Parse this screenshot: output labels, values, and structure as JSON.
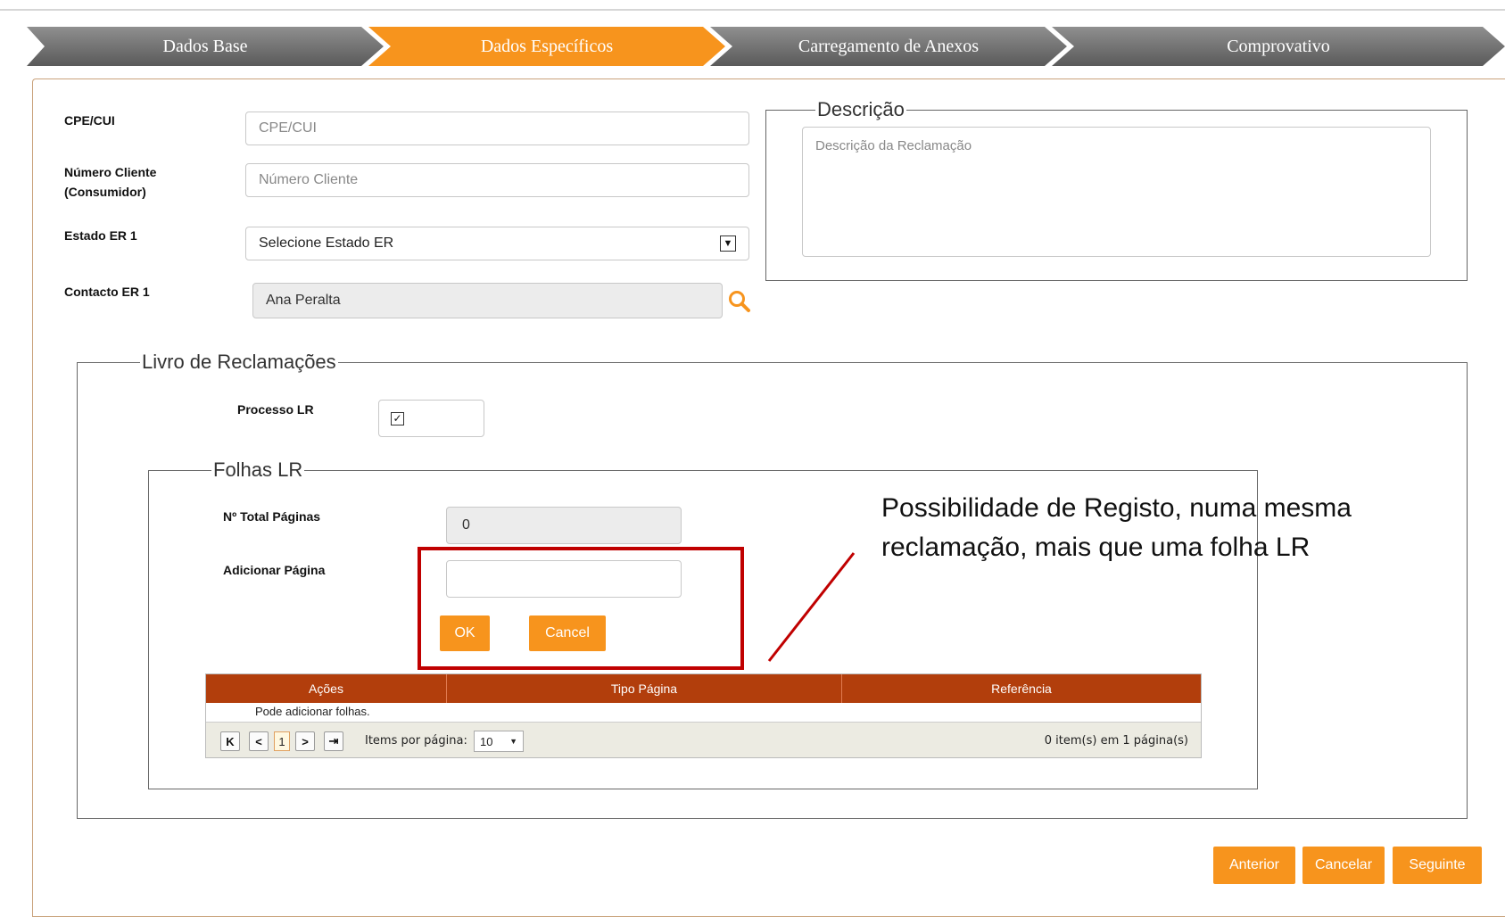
{
  "steps": [
    "Dados Base",
    "Dados Específicos",
    "Carregamento de Anexos",
    "Comprovativo"
  ],
  "form": {
    "cpe_label": "CPE/CUI",
    "cpe_placeholder": "CPE/CUI",
    "numero_label": "Número Cliente (Consumidor)",
    "numero_placeholder": "Número Cliente",
    "estado_label": "Estado ER 1",
    "estado_value": "Selecione Estado ER",
    "contacto_label": "Contacto ER 1",
    "contacto_value": "Ana Peralta"
  },
  "descricao": {
    "legend": "Descrição",
    "placeholder": "Descrição da Reclamação"
  },
  "livro": {
    "legend": "Livro de Reclamações",
    "processo_label": "Processo LR",
    "processo_checked": true
  },
  "folhas": {
    "legend": "Folhas LR",
    "total_label": "Nº Total Páginas",
    "total_value": "0",
    "adicionar_label": "Adicionar Página",
    "adicionar_value": "",
    "ok_label": "OK",
    "cancel_label": "Cancel"
  },
  "grid": {
    "columns": [
      "Ações",
      "Tipo Página",
      "Referência"
    ],
    "empty_message": "Pode adicionar folhas.",
    "current_page": "1",
    "items_per_page_label": "Items por página:",
    "items_per_page_value": "10",
    "summary": "0 item(s) em 1 página(s)"
  },
  "annotation": "Possibilidade de Registo, numa mesma reclamação, mais que uma folha LR",
  "footer": {
    "anterior": "Anterior",
    "cancelar": "Cancelar",
    "seguinte": "Seguinte"
  },
  "colors": {
    "accent": "#f7941d",
    "grid_header": "#b23e0c",
    "annotation_red": "#c00000"
  }
}
